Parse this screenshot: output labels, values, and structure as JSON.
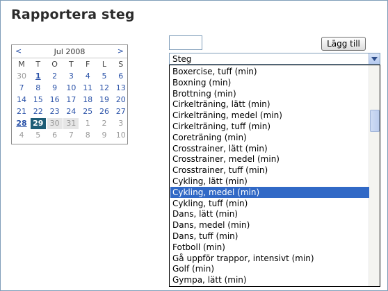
{
  "title": "Rapportera steg",
  "calendar": {
    "prev": "<",
    "next": ">",
    "month_label": "Jul 2008",
    "weekdays": [
      "M",
      "T",
      "O",
      "T",
      "F",
      "L",
      "S"
    ],
    "weeks": [
      [
        "30",
        "1",
        "2",
        "3",
        "4",
        "5",
        "6"
      ],
      [
        "7",
        "8",
        "9",
        "10",
        "11",
        "12",
        "13"
      ],
      [
        "14",
        "15",
        "16",
        "17",
        "18",
        "19",
        "20"
      ],
      [
        "21",
        "22",
        "23",
        "24",
        "25",
        "26",
        "27"
      ],
      [
        "28",
        "29",
        "30",
        "31",
        "1",
        "2",
        "3"
      ],
      [
        "4",
        "5",
        "6",
        "7",
        "8",
        "9",
        "10"
      ]
    ]
  },
  "form": {
    "steps_value": "",
    "add_label": "Lägg till",
    "select_value": "Steg"
  },
  "dropdown": {
    "options": [
      "Boxercise, tuff (min)",
      "Boxning (min)",
      "Brottning (min)",
      "Cirkelträning, lätt (min)",
      "Cirkelträning, medel (min)",
      "Cirkelträning, tuff (min)",
      "Coreträning (min)",
      "Crosstrainer, lätt (min)",
      "Crosstrainer, medel (min)",
      "Crosstrainer, tuff (min)",
      "Cykling, lätt (min)",
      "Cykling, medel (min)",
      "Cykling, tuff (min)",
      "Dans, lätt (min)",
      "Dans, medel (min)",
      "Dans, tuff (min)",
      "Fotboll (min)",
      "Gå uppför trappor, intensivt (min)",
      "Golf (min)",
      "Gympa, lätt (min)"
    ],
    "highlighted_index": 11
  }
}
